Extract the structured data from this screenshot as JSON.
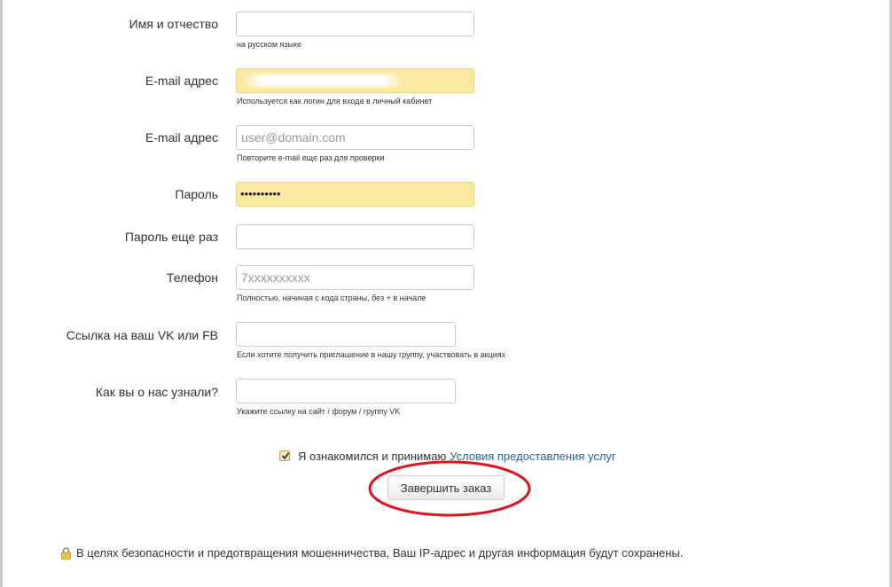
{
  "form": {
    "fields": [
      {
        "label": "Имя и отчество",
        "value": "",
        "placeholder": "",
        "hint": "на русском языке"
      },
      {
        "label": "E-mail адрес",
        "value": "",
        "placeholder": "",
        "hint": "Используется как логин для входа в личный кабинет"
      },
      {
        "label": "E-mail адрес",
        "value": "",
        "placeholder": "user@domain.com",
        "hint": "Повторите e-mail еще раз для проверки"
      },
      {
        "label": "Пароль",
        "value": "••••••••••",
        "placeholder": "",
        "hint": ""
      },
      {
        "label": "Пароль еще раз",
        "value": "",
        "placeholder": "",
        "hint": ""
      },
      {
        "label": "Телефон",
        "value": "",
        "placeholder": "7xxxxxxxxxx",
        "hint": "Полностью, начиная с кода страны, без + в начале"
      },
      {
        "label": "Ссылка на ваш VK или FB",
        "value": "",
        "placeholder": "",
        "hint": "Если хотите получить приглашение в нашу группу, участвовать в акциях"
      },
      {
        "label": "Как вы о нас узнали?",
        "value": "",
        "placeholder": "",
        "hint": "Укажите ссылку на сайт / форум / группу VK"
      }
    ],
    "agreement": {
      "checked": true,
      "text": "Я ознакомился и принимаю",
      "link": "Условия предоставления услуг"
    },
    "submit_label": "Завершить заказ"
  },
  "security_notice": "В целях безопасности и предотвращения мошенничества, Ваш IP-адрес и другая информация будут сохранены.",
  "colors": {
    "autofill": "#fbe9a0",
    "link": "#2a6496",
    "annotation": "#e0141e"
  },
  "icons": [
    "lock-icon",
    "checkmark-icon"
  ]
}
